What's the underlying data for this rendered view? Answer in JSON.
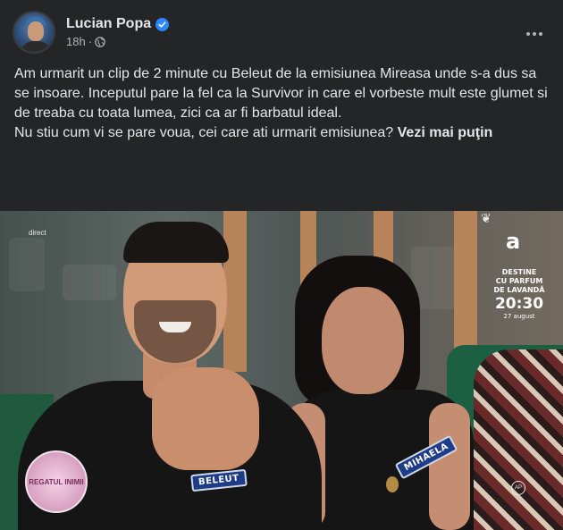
{
  "post": {
    "author": "Lucian Popa",
    "time": "18h",
    "separator": "·",
    "text_paragraph_1": "Am urmarit un clip de 2 minute cu Beleut de la emisiunea Mireasa unde s-a dus sa se insoare. Inceputul pare la fel ca la Survivor in care el vorbeste mult este glumet si de treaba cu toata lumea, zici ca ar fi barbatul ideal.",
    "text_paragraph_2": "Nu stiu cum vi se pare voua, cei care ati urmarit emisiunea?",
    "see_more": "Vezi mai puţin"
  },
  "media": {
    "live_label": "direct",
    "name_tag_1": "BELEUT",
    "name_tag_2": "MIHAELA",
    "watermark_text": "REGATUL INIMII",
    "channel_logo": "a",
    "promo_line1": "DESTINE",
    "promo_line2": "CU PARFUM",
    "promo_line3": "DE LAVANDĂ",
    "promo_time": "20:30",
    "promo_date": "27 august",
    "ap_badge": "AP"
  },
  "icons": {
    "verified": "verified-badge-icon",
    "globe": "globe-icon",
    "more": "more-options-icon"
  },
  "colors": {
    "background": "#242526",
    "text": "#e4e6eb",
    "muted": "#b0b3b8",
    "verified": "#2d88ff"
  }
}
